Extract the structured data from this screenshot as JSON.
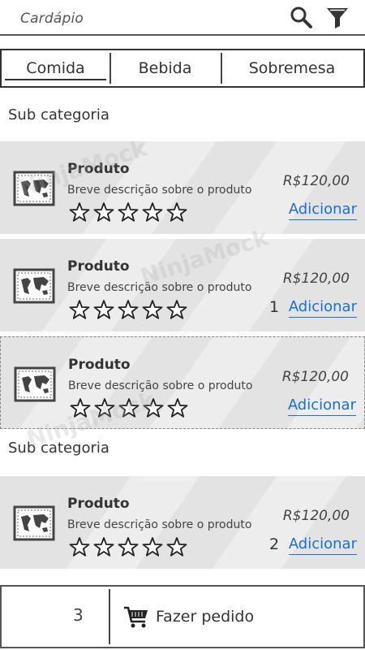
{
  "header": {
    "title": "Cardápio",
    "search_icon": "search-icon",
    "filter_icon": "filter-icon"
  },
  "tabs": [
    {
      "label": "Comida",
      "active": true
    },
    {
      "label": "Bebida",
      "active": false
    },
    {
      "label": "Sobremesa",
      "active": false
    }
  ],
  "sections": [
    {
      "title": "Sub categoria",
      "products": [
        {
          "name": "Produto",
          "description": "Breve descrição sobre o produto",
          "price": "R$120,00",
          "quantity": "",
          "add_label": "Adicionar",
          "rating": 0,
          "max_rating": 5
        },
        {
          "name": "Produto",
          "description": "Breve descrição sobre o produto",
          "price": "R$120,00",
          "quantity": "1",
          "add_label": "Adicionar",
          "rating": 0,
          "max_rating": 5
        },
        {
          "name": "Produto",
          "description": "Breve descrição sobre o produto",
          "price": "R$120,00",
          "quantity": "",
          "add_label": "Adicionar",
          "rating": 0,
          "max_rating": 5
        }
      ]
    },
    {
      "title": "Sub categoria",
      "products": [
        {
          "name": "Produto",
          "description": "Breve descrição sobre o produto",
          "price": "R$120,00",
          "quantity": "2",
          "add_label": "Adicionar",
          "rating": 0,
          "max_rating": 5
        }
      ]
    }
  ],
  "footer": {
    "item_count": "3",
    "order_label": "Fazer pedido",
    "cart_icon": "shopping-cart-icon"
  },
  "watermark": "NinjaMock",
  "colors": {
    "card_background": "#e3e3e3",
    "link": "#1a6fd6",
    "ink": "#333333"
  }
}
